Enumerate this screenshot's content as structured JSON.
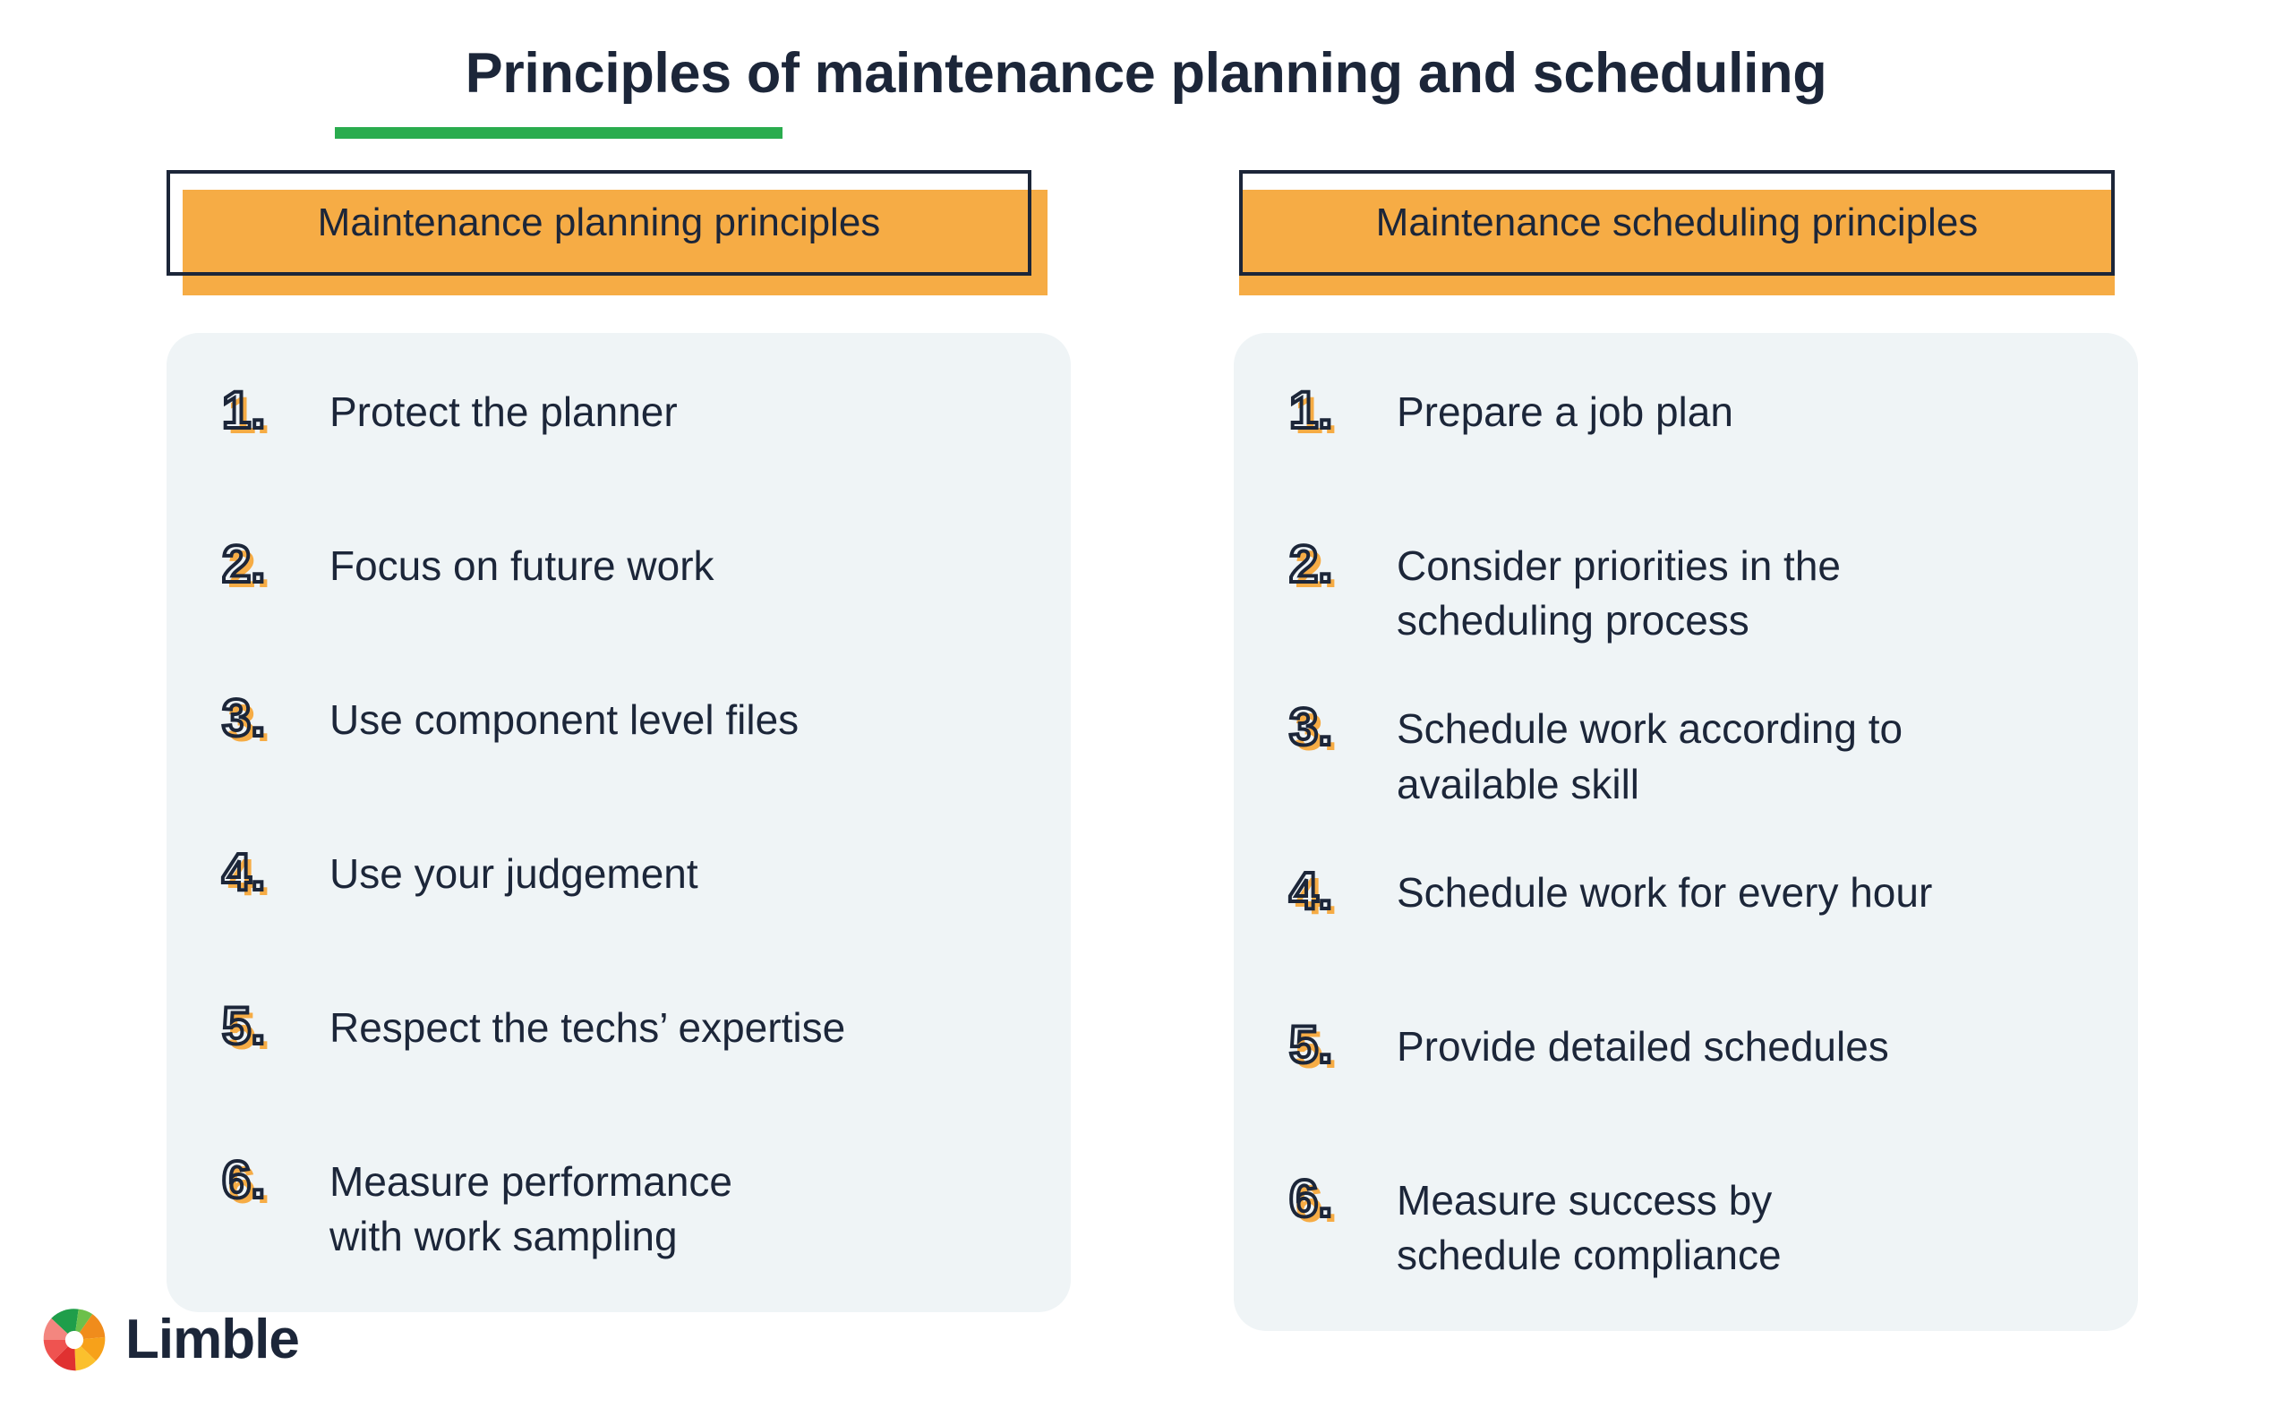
{
  "title": "Principles of maintenance planning and scheduling",
  "accent_colors": {
    "underline_green": "#2aac4e",
    "header_orange": "#f6ac45",
    "text_navy": "#1c2639",
    "panel_bg": "#eff4f6",
    "page_bg": "#ffffff"
  },
  "columns": [
    {
      "header": "Maintenance planning principles",
      "items": [
        {
          "number": "1.",
          "text": "Protect the planner"
        },
        {
          "number": "2.",
          "text": "Focus on future work"
        },
        {
          "number": "3.",
          "text": "Use component level files"
        },
        {
          "number": "4.",
          "text": "Use your judgement"
        },
        {
          "number": "5.",
          "text": "Respect the techs’ expertise"
        },
        {
          "number": "6.",
          "text": "Measure performance\nwith work sampling"
        }
      ]
    },
    {
      "header": "Maintenance scheduling principles",
      "items": [
        {
          "number": "1.",
          "text": "Prepare a job plan"
        },
        {
          "number": "2.",
          "text": "Consider priorities in the\nscheduling process"
        },
        {
          "number": "3.",
          "text": "Schedule work according to\navailable skill"
        },
        {
          "number": "4.",
          "text": "Schedule work for every hour"
        },
        {
          "number": "5.",
          "text": "Provide detailed schedules"
        },
        {
          "number": "6.",
          "text": "Measure success by\nschedule compliance"
        }
      ]
    }
  ],
  "logo": {
    "name": "Limble",
    "mark": "limble-gear-icon"
  }
}
